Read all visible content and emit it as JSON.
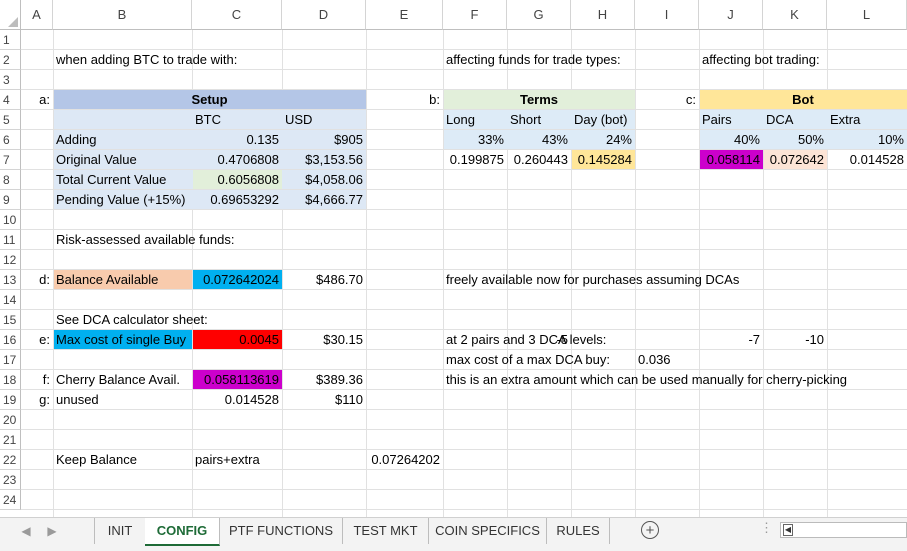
{
  "columns": [
    "A",
    "B",
    "C",
    "D",
    "E",
    "F",
    "G",
    "H",
    "I",
    "J",
    "K",
    "L"
  ],
  "rows": [
    "1",
    "2",
    "3",
    "4",
    "5",
    "6",
    "7",
    "8",
    "9",
    "10",
    "11",
    "12",
    "13",
    "14",
    "15",
    "16",
    "17",
    "18",
    "19",
    "20",
    "21",
    "22",
    "23",
    "24"
  ],
  "cells": {
    "B2": "when adding BTC to trade with:",
    "F2": "affecting funds for trade types:",
    "J2": "affecting bot trading:",
    "A4": "a:",
    "setup_header": "Setup",
    "D4": "b:",
    "terms_header": "Terms",
    "I4": "c:",
    "bot_header": "Bot",
    "C5": "BTC",
    "D5": "USD",
    "F5": "Long",
    "G5": "Short",
    "H5": "Day (bot)",
    "J5": "Pairs",
    "K5": "DCA",
    "L5": "Extra",
    "B6": "Adding",
    "C6": "0.135",
    "D6": "$905",
    "F6": "33%",
    "G6": "43%",
    "H6": "24%",
    "J6": "40%",
    "K6": "50%",
    "L6": "10%",
    "B7": "Original Value",
    "C7": "0.4706808",
    "D7": "$3,153.56",
    "F7": "0.199875",
    "G7": "0.260443",
    "H7": "0.145284",
    "J7": "0.058114",
    "K7": "0.072642",
    "L7": "0.014528",
    "B8": "Total Current Value",
    "C8": "0.6056808",
    "D8": "$4,058.06",
    "B9": "Pending Value (+15%)",
    "C9": "0.69653292",
    "D9": "$4,666.77",
    "B11": "Risk-assessed available funds:",
    "A13": "d:",
    "B13": "Balance Available",
    "C13": "0.072642024",
    "D13": "$486.70",
    "F13": "freely available now for purchases assuming DCAs",
    "B15": "See DCA calculator sheet:",
    "A16": "e:",
    "B16": "Max cost of single Buy",
    "C16": "0.0045",
    "D16": "$30.15",
    "F16": "at 2 pairs and 3 DCA levels:",
    "H16": "-5",
    "J16": "-7",
    "K16": "-10",
    "F17": "max cost of a max DCA buy:",
    "I17": "0.036",
    "A18": "f:",
    "B18": "Cherry Balance Avail.",
    "C18": "0.058113619",
    "D18": "$389.36",
    "F18": "this is an extra amount which can be used manually for cherry-picking",
    "A19": "g:",
    "B19": "unused",
    "C19": "0.014528",
    "D19": "$110",
    "B22": "Keep Balance",
    "C22": "pairs+extra",
    "E22": "0.07264202"
  },
  "colors": {
    "setup_header": "#b4c6e7",
    "setup_body": "#dde8f5",
    "terms_header": "#e2efda",
    "terms_body": "#ddebf7",
    "bot_header": "#ffe699",
    "bot_body": "#ddebf7",
    "current_value_btc": "#e2efda",
    "highlight_yellow": "#ffe699",
    "magenta": "#cc00cc",
    "peach": "#fce4d6",
    "balance_label": "#f8cbad",
    "balance_value": "#00b0f0",
    "dca_label": "#00b0f0",
    "dca_value": "#ff0000",
    "active_tab": "#1e6b37"
  },
  "sheet_tabs": [
    "INIT",
    "CONFIG",
    "PTF FUNCTIONS",
    "TEST MKT",
    "COIN SPECIFICS",
    "RULES"
  ],
  "active_tab": "CONFIG"
}
